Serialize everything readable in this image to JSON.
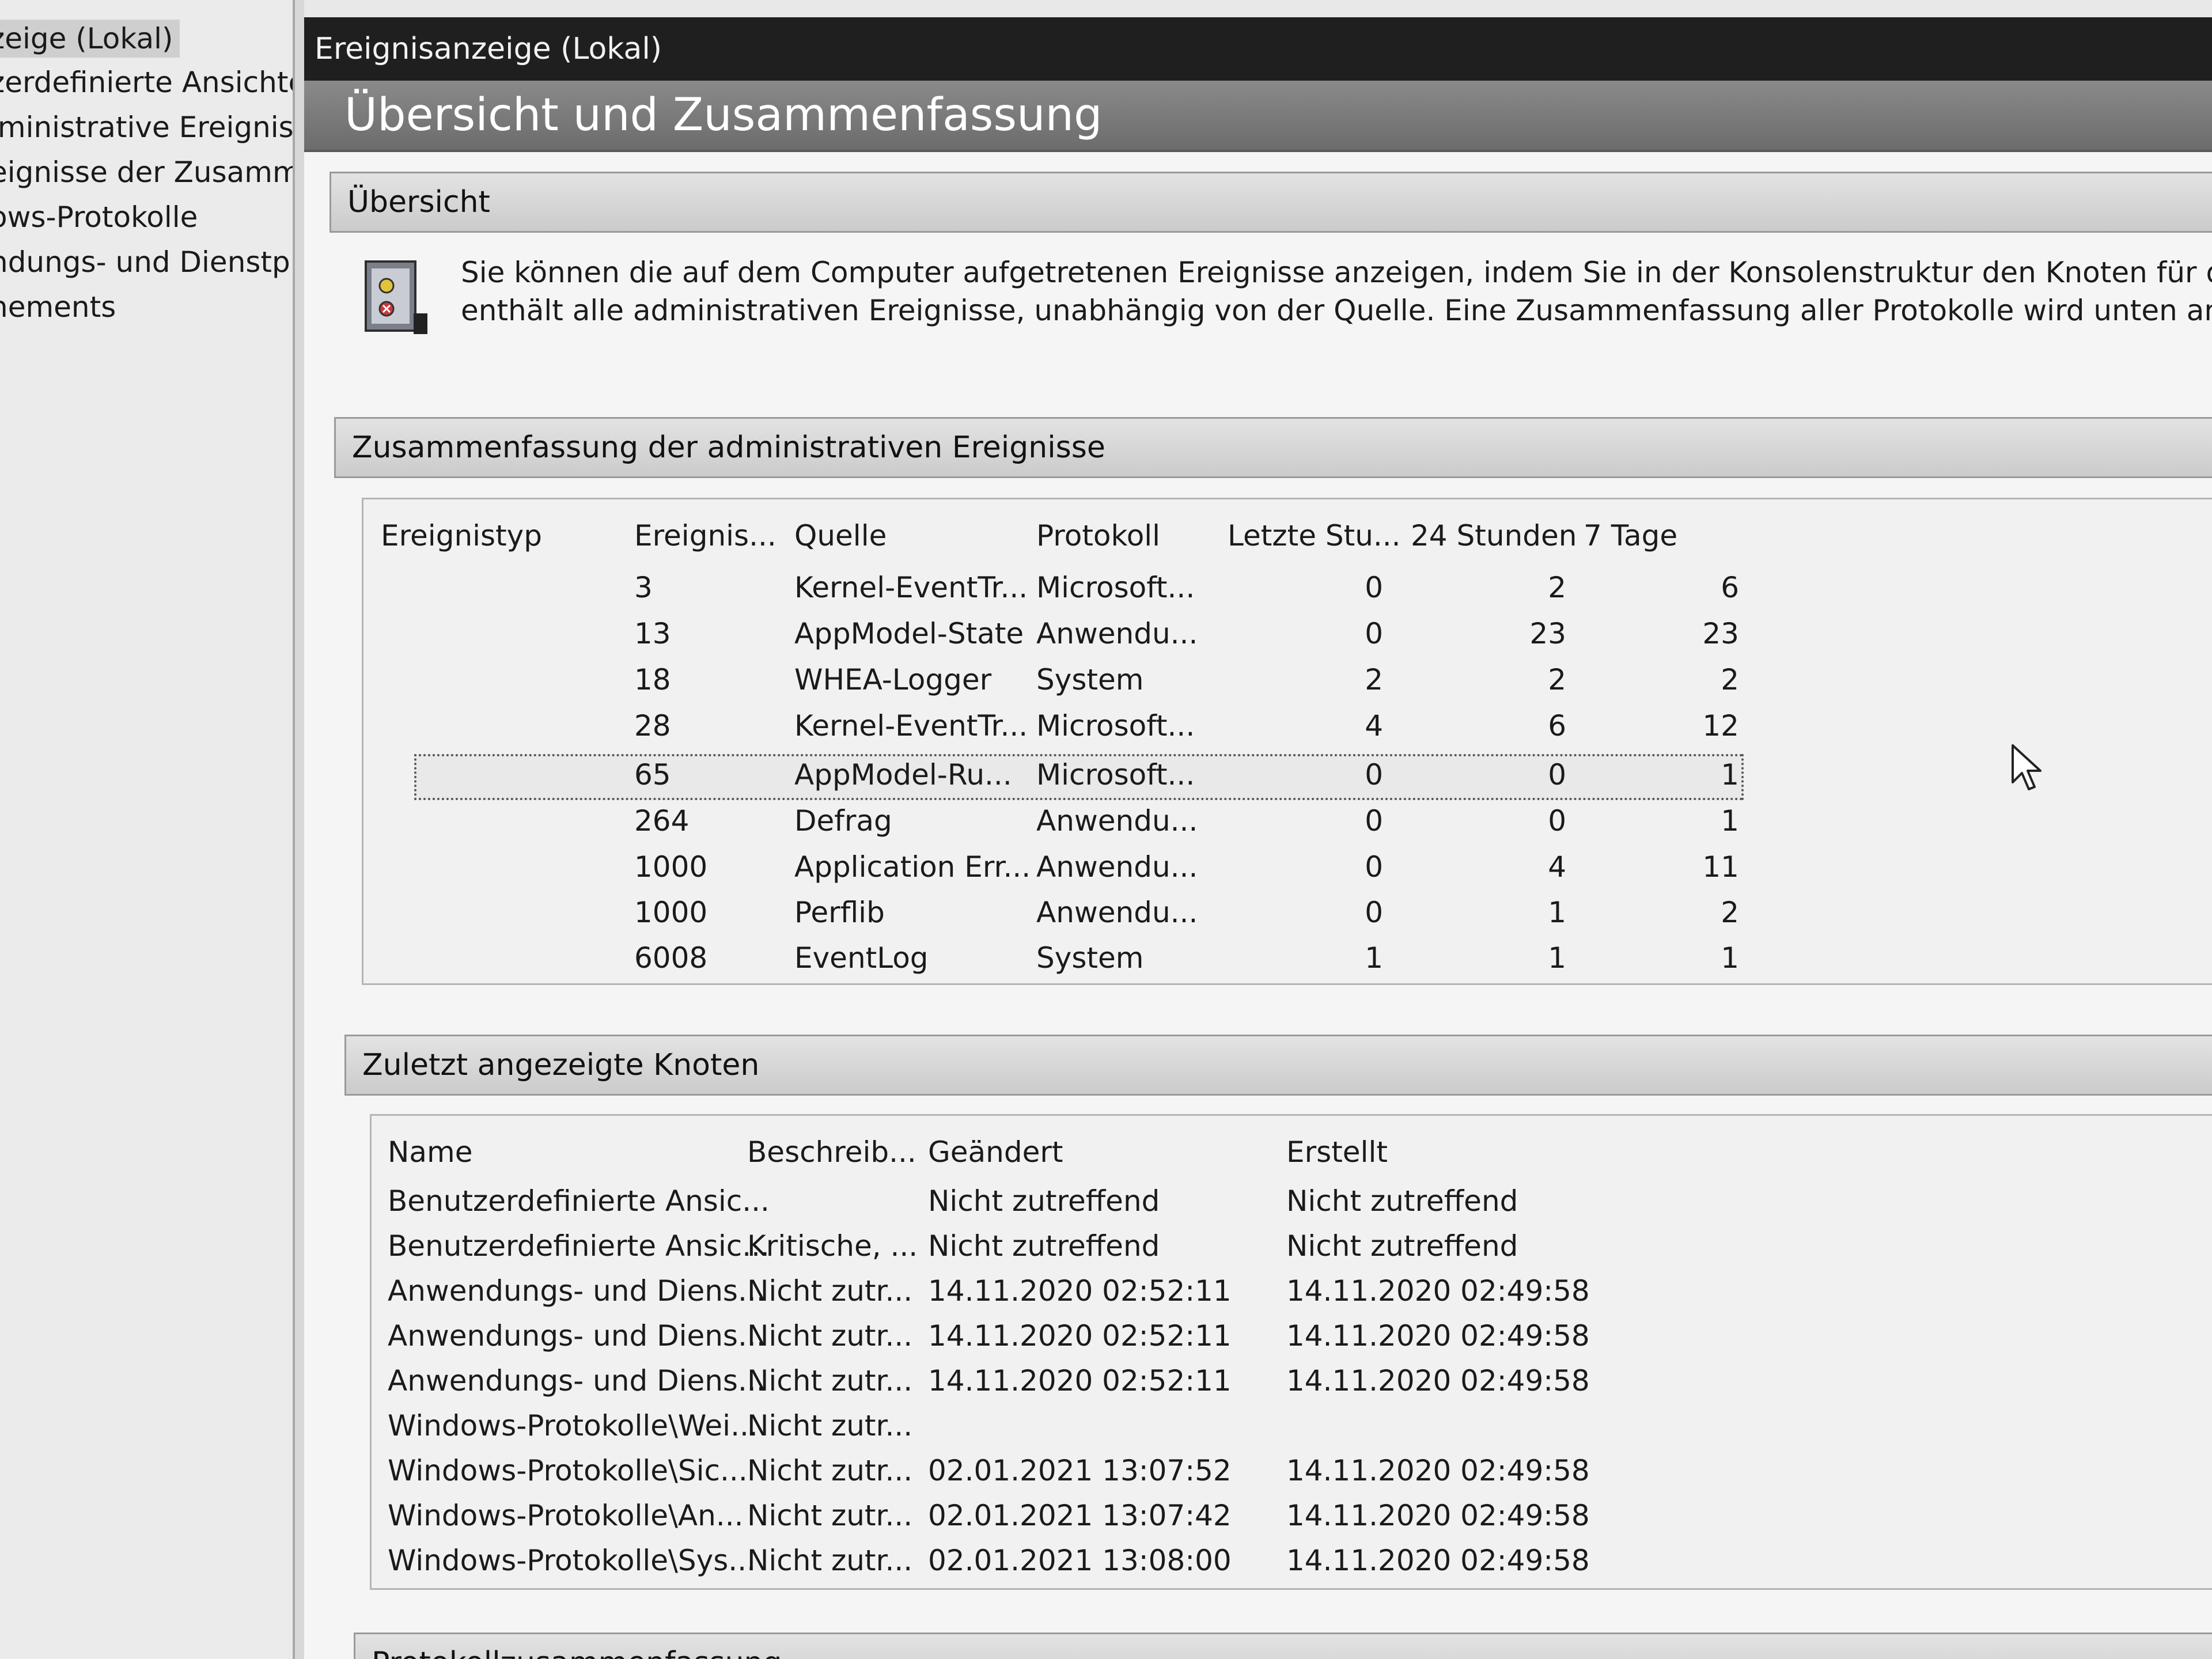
{
  "tree": {
    "items": [
      {
        "label": "zeige (Lokal)"
      },
      {
        "label": "zerdefinierte Ansichten"
      },
      {
        "label": "lministrative Ereignisse"
      },
      {
        "label": "eignisse der Zusammenf"
      },
      {
        "label": "ows-Protokolle"
      },
      {
        "label": "ndungs- und Dienstprot"
      },
      {
        "label": "nements"
      }
    ]
  },
  "header": {
    "title": "Ereignisanzeige (Lokal)"
  },
  "page": {
    "title": "Übersicht und Zusammenfassung"
  },
  "overview": {
    "label": "Übersicht",
    "icon": "event-log-icon",
    "line1": "Sie können die auf dem Computer aufgetretenen Ereignisse anzeigen, indem Sie in der Konsolenstruktur den Knoten für die Quelle, das P",
    "line2": "enthält alle administrativen Ereignisse, unabhängig von der Quelle. Eine Zusammenfassung aller Protokolle wird unten angezeigt."
  },
  "summary": {
    "label": "Zusammenfassung der administrativen Ereignisse",
    "columns": [
      "Ereignistyp",
      "Ereignis...",
      "Quelle",
      "Protokoll",
      "Letzte Stu...",
      "24 Stunden",
      "7 Tage"
    ],
    "rows": [
      {
        "type": "",
        "id": "3",
        "source": "Kernel-EventTr...",
        "log": "Microsoft...",
        "hour": "0",
        "day": "2",
        "week": "6"
      },
      {
        "type": "",
        "id": "13",
        "source": "AppModel-State",
        "log": "Anwendu...",
        "hour": "0",
        "day": "23",
        "week": "23"
      },
      {
        "type": "",
        "id": "18",
        "source": "WHEA-Logger",
        "log": "System",
        "hour": "2",
        "day": "2",
        "week": "2"
      },
      {
        "type": "",
        "id": "28",
        "source": "Kernel-EventTr...",
        "log": "Microsoft...",
        "hour": "4",
        "day": "6",
        "week": "12"
      },
      {
        "type": "",
        "id": "65",
        "source": "AppModel-Ru...",
        "log": "Microsoft...",
        "hour": "0",
        "day": "0",
        "week": "1"
      },
      {
        "type": "",
        "id": "264",
        "source": "Defrag",
        "log": "Anwendu...",
        "hour": "0",
        "day": "0",
        "week": "1"
      },
      {
        "type": "",
        "id": "1000",
        "source": "Application Err...",
        "log": "Anwendu...",
        "hour": "0",
        "day": "4",
        "week": "11"
      },
      {
        "type": "",
        "id": "1000",
        "source": "Perflib",
        "log": "Anwendu...",
        "hour": "0",
        "day": "1",
        "week": "2"
      },
      {
        "type": "",
        "id": "6008",
        "source": "EventLog",
        "log": "System",
        "hour": "1",
        "day": "1",
        "week": "1"
      }
    ]
  },
  "recent": {
    "label": "Zuletzt angezeigte Knoten",
    "columns": [
      "Name",
      "Beschreib...",
      "Geändert",
      "Erstellt"
    ],
    "rows": [
      {
        "name": "Benutzerdefinierte Ansic...",
        "desc": "",
        "changed": "Nicht zutreffend",
        "created": "Nicht zutreffend"
      },
      {
        "name": "Benutzerdefinierte Ansic...",
        "desc": "Kritische, ...",
        "changed": "Nicht zutreffend",
        "created": "Nicht zutreffend"
      },
      {
        "name": "Anwendungs- und Diens...",
        "desc": "Nicht zutr...",
        "changed": "14.11.2020 02:52:11",
        "created": "14.11.2020 02:49:58"
      },
      {
        "name": "Anwendungs- und Diens...",
        "desc": "Nicht zutr...",
        "changed": "14.11.2020 02:52:11",
        "created": "14.11.2020 02:49:58"
      },
      {
        "name": "Anwendungs- und Diens...",
        "desc": "Nicht zutr...",
        "changed": "14.11.2020 02:52:11",
        "created": "14.11.2020 02:49:58"
      },
      {
        "name": "Windows-Protokolle\\Wei...",
        "desc": "Nicht zutr...",
        "changed": "",
        "created": ""
      },
      {
        "name": "Windows-Protokolle\\Sic...",
        "desc": "Nicht zutr...",
        "changed": "02.01.2021 13:07:52",
        "created": "14.11.2020 02:49:58"
      },
      {
        "name": "Windows-Protokolle\\An...",
        "desc": "Nicht zutr...",
        "changed": "02.01.2021 13:07:42",
        "created": "14.11.2020 02:49:58"
      },
      {
        "name": "Windows-Protokolle\\Sys...",
        "desc": "Nicht zutr...",
        "changed": "02.01.2021 13:08:00",
        "created": "14.11.2020 02:49:58"
      }
    ]
  },
  "logsummary": {
    "label": "Protokollzusammenfassung"
  }
}
